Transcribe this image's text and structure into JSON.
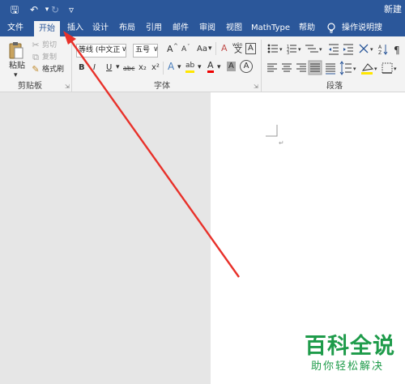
{
  "titlebar": {
    "doc_title": "新建",
    "save_glyph": "🖫",
    "undo_glyph": "↶",
    "redo_glyph": "↻",
    "customize_glyph": "▿",
    "restore_glyph": "▭"
  },
  "tabs": [
    {
      "label": "文件"
    },
    {
      "label": "开始"
    },
    {
      "label": "插入"
    },
    {
      "label": "设计"
    },
    {
      "label": "布局"
    },
    {
      "label": "引用"
    },
    {
      "label": "邮件"
    },
    {
      "label": "审阅"
    },
    {
      "label": "视图"
    },
    {
      "label": "MathType"
    },
    {
      "label": "帮助"
    }
  ],
  "tell_me": {
    "label": "操作说明搜索",
    "icon": "lightbulb-icon"
  },
  "clipboard": {
    "group_label": "剪贴板",
    "paste_label": "粘贴",
    "cut_label": "剪切",
    "copy_label": "复制",
    "format_painter_label": "格式刷"
  },
  "font": {
    "group_label": "字体",
    "font_name": "等线 (中文正文",
    "font_size": "五号",
    "grow_glyph": "A",
    "shrink_glyph": "A",
    "case_glyph": "Aa",
    "clear_glyph": "A",
    "phonetic_glyph": "wén",
    "border_glyph": "A",
    "bold": "B",
    "italic": "I",
    "underline": "U",
    "strike": "abc",
    "subscript": "x₂",
    "superscript": "x²",
    "effects_glyph": "A",
    "highlight_glyph": "ab",
    "color_glyph": "A",
    "shade_glyph": "A",
    "circle_glyph": "A"
  },
  "paragraph": {
    "group_label": "段落"
  },
  "colors": {
    "accent": "#2b579a",
    "arrow": "#e8312a",
    "watermark": "#1e9b4a"
  },
  "watermark": {
    "title": "百科全说",
    "subtitle": "助你轻松解决"
  }
}
